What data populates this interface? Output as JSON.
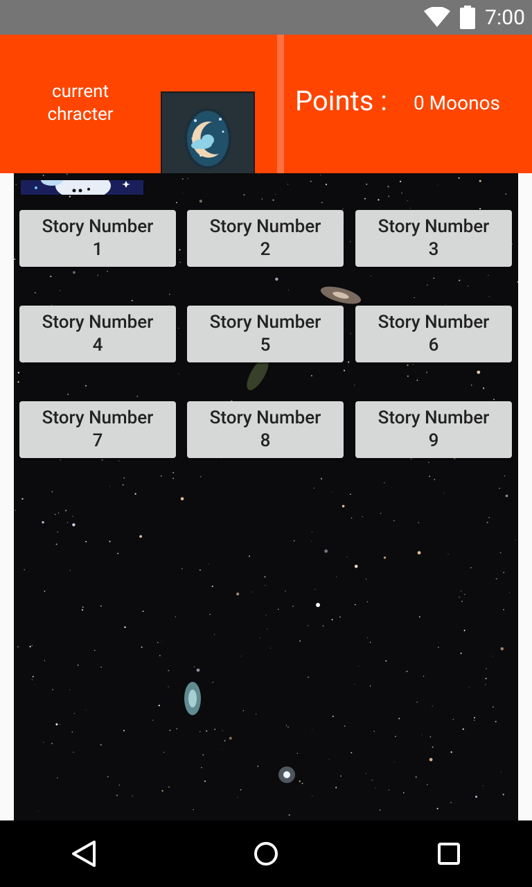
{
  "status_bar": {
    "time": "7:00",
    "icons": [
      "wifi-icon",
      "battery-icon"
    ]
  },
  "header": {
    "current_character_label": "current chracter",
    "character_icon": "moon-cloud-icon",
    "points_label": "Points :",
    "points_value": "0 Moonos",
    "colors": {
      "background": "#ff4500",
      "divider": "#ff7043"
    }
  },
  "stories": [
    {
      "label": "Story Number",
      "number": "1"
    },
    {
      "label": "Story Number",
      "number": "2"
    },
    {
      "label": "Story Number",
      "number": "3"
    },
    {
      "label": "Story Number",
      "number": "4"
    },
    {
      "label": "Story Number",
      "number": "5"
    },
    {
      "label": "Story Number",
      "number": "6"
    },
    {
      "label": "Story Number",
      "number": "7"
    },
    {
      "label": "Story Number",
      "number": "8"
    },
    {
      "label": "Story Number",
      "number": "9"
    }
  ],
  "nav_bar": {
    "buttons": [
      "back-icon",
      "home-icon",
      "recents-icon"
    ]
  }
}
